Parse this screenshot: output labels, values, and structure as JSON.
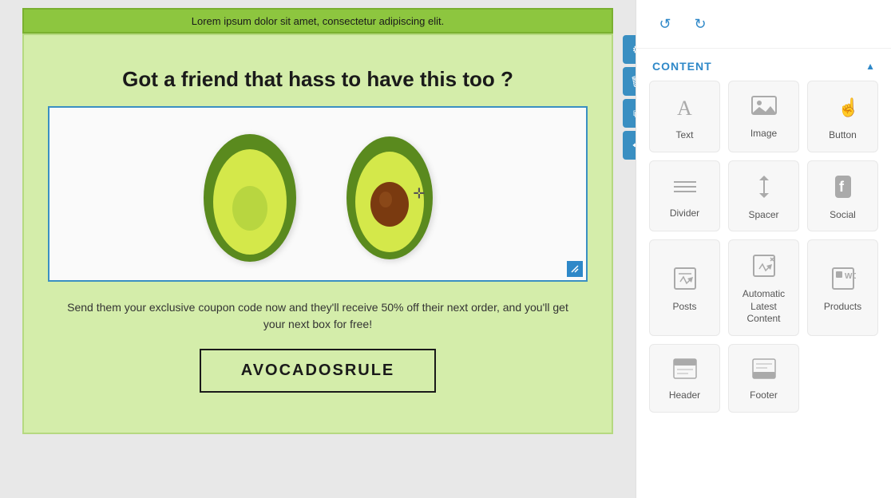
{
  "undo_redo": {
    "undo_label": "↺",
    "redo_label": "↻"
  },
  "panel": {
    "content_title": "CONTENT",
    "collapse_arrow": "▲"
  },
  "email": {
    "top_bar_text": "Lorem ipsum dolor sit amet, consectetur adipiscing elit.",
    "heading": "Got a friend that hass to have this too ?",
    "coupon_text": "Send them your exclusive coupon code now and they'll receive 50% off their next order, and you'll get your next box for free!",
    "coupon_code": "AVOCADOSRULE"
  },
  "toolbar": {
    "settings_icon": "⚙",
    "delete_icon": "🗑",
    "duplicate_icon": "⧉",
    "move_icon": "✥"
  },
  "content_items": [
    {
      "id": "text",
      "label": "Text",
      "icon_class": "icon-text"
    },
    {
      "id": "image",
      "label": "Image",
      "icon_class": "icon-image"
    },
    {
      "id": "button",
      "label": "Button",
      "icon_class": "icon-button"
    },
    {
      "id": "divider",
      "label": "Divider",
      "icon_class": "icon-divider"
    },
    {
      "id": "spacer",
      "label": "Spacer",
      "icon_class": "icon-spacer"
    },
    {
      "id": "social",
      "label": "Social",
      "icon_class": "icon-social"
    },
    {
      "id": "posts",
      "label": "Posts",
      "icon_class": "icon-posts"
    },
    {
      "id": "alc",
      "label": "Automatic Latest Content",
      "icon_class": "icon-alc"
    },
    {
      "id": "products",
      "label": "Products",
      "icon_class": "icon-products"
    },
    {
      "id": "header",
      "label": "Header",
      "icon_class": "icon-header"
    },
    {
      "id": "footer",
      "label": "Footer",
      "icon_class": "icon-footer"
    }
  ],
  "colors": {
    "top_bar_bg": "#8dc63f",
    "email_bg": "#d4edaa",
    "active_blue": "#2e88c8",
    "panel_bg": "#ffffff"
  }
}
